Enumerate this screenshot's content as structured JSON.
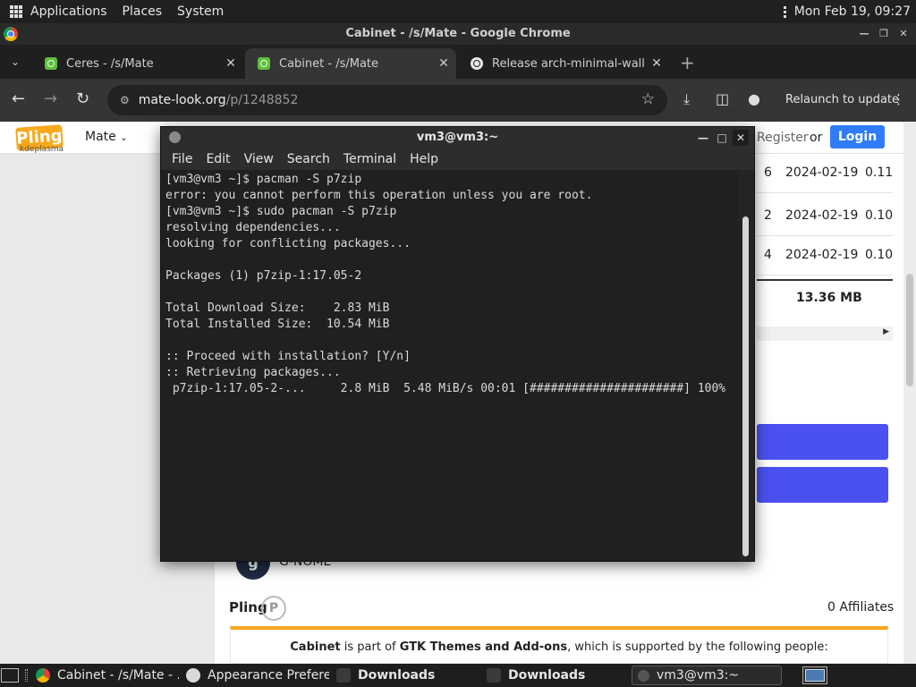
{
  "top_panel": {
    "menus": [
      "Applications",
      "Places",
      "System"
    ],
    "clock": "Mon Feb 19, 09:27"
  },
  "chrome": {
    "window_title": "Cabinet - /s/Mate - Google Chrome",
    "tabs": [
      {
        "label": "Ceres - /s/Mate",
        "icon": "pling-icon",
        "active": false
      },
      {
        "label": "Cabinet - /s/Mate",
        "icon": "pling-icon",
        "active": true
      },
      {
        "label": "Release arch-minimal-wallp",
        "icon": "github-icon",
        "active": false
      }
    ],
    "url_host": "mate-look.org",
    "url_path": "/p/1248852",
    "relaunch_label": "Relaunch to update"
  },
  "page": {
    "logo_text": "Pling",
    "logo_sub": "kdeplasma",
    "store_label": "Mate",
    "register_label": "Register",
    "or_label": "or",
    "login_label": "Login",
    "files": [
      {
        "downloads": "6",
        "date": "2024-02-19",
        "size": "0.11"
      },
      {
        "downloads": "2",
        "date": "2024-02-19",
        "size": "0.10"
      },
      {
        "downloads": "4",
        "date": "2024-02-19",
        "size": "0.10"
      }
    ],
    "total_size": "13.36 MB",
    "avatar_letter": "g",
    "supporter_name": "G-NOME",
    "pling_heading": "Pling",
    "affiliates": "0 Affiliates",
    "supporters_prefix": "Cabinet",
    "supporters_middle": " is part of ",
    "supporters_link": "GTK Themes and Add-ons",
    "supporters_suffix": ", which is supported by the following people:"
  },
  "terminal": {
    "title": "vm3@vm3:~",
    "menu": [
      "File",
      "Edit",
      "View",
      "Search",
      "Terminal",
      "Help"
    ],
    "lines": [
      "[vm3@vm3 ~]$ pacman -S p7zip",
      "error: you cannot perform this operation unless you are root.",
      "[vm3@vm3 ~]$ sudo pacman -S p7zip",
      "resolving dependencies...",
      "looking for conflicting packages...",
      "",
      "Packages (1) p7zip-1:17.05-2",
      "",
      "Total Download Size:    2.83 MiB",
      "Total Installed Size:  10.54 MiB",
      "",
      ":: Proceed with installation? [Y/n]",
      ":: Retrieving packages...",
      " p7zip-1:17.05-2-...     2.8 MiB  5.48 MiB/s 00:01 [######################] 100%"
    ]
  },
  "taskbar": {
    "tasks": [
      {
        "label": "Cabinet - /s/Mate - ...",
        "icon": "chrome-icon",
        "bold": false
      },
      {
        "label": "Appearance Prefere...",
        "icon": "appearance-icon",
        "bold": false
      },
      {
        "label": "Downloads",
        "icon": "folder-icon",
        "bold": true
      },
      {
        "label": "Downloads",
        "icon": "folder-icon",
        "bold": true
      },
      {
        "label": "vm3@vm3:~",
        "icon": "terminal-icon",
        "bold": false
      }
    ]
  },
  "colors": {
    "pling_orange": "#f7a81b",
    "login_blue": "#2f7cf6",
    "download_button": "#4b50f0"
  }
}
